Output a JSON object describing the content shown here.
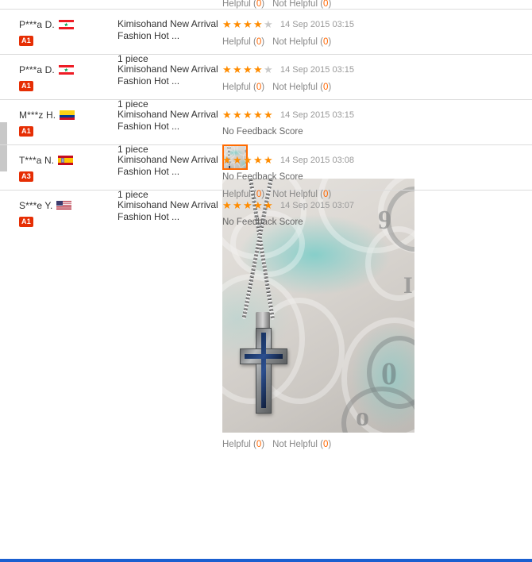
{
  "meta": {
    "accent_orange": "#ff6600",
    "star_on_color": "#ff8c00",
    "star_off_color": "#c9c9c9",
    "badge_color": "#e62e04",
    "divider_color": "#dcdcdc",
    "bottom_bar_color": "#1a5fd0"
  },
  "labels": {
    "helpful": "Helpful",
    "not_helpful": "Not Helpful",
    "no_feedback_score": "No Feedback Score",
    "open_paren": "(",
    "close_paren": ")"
  },
  "clipped_top_row": {
    "helpful_label": "Helpful",
    "helpful_count": "0",
    "not_helpful_label": "Not Helpful",
    "not_helpful_count": "0"
  },
  "reviews": [
    {
      "user": "P***a D.",
      "flag": "lebanon-flag",
      "badge": "A1",
      "product_title": "Kimisohand New Arrival Fashion Hot ...",
      "quantity": "1 piece",
      "rating": 4,
      "date": "14 Sep 2015 03:15",
      "feedback_score": "",
      "helpful_count": "0",
      "not_helpful_count": "0",
      "has_photo": false
    },
    {
      "user": "P***a D.",
      "flag": "lebanon-flag",
      "badge": "A1",
      "product_title": "Kimisohand New Arrival Fashion Hot ...",
      "quantity": "1 piece",
      "rating": 4,
      "date": "14 Sep 2015 03:15",
      "feedback_score": "",
      "helpful_count": "0",
      "not_helpful_count": "0",
      "has_photo": false
    },
    {
      "user": "M***z H.",
      "flag": "colombia-flag",
      "badge": "A1",
      "product_title": "Kimisohand New Arrival Fashion Hot ...",
      "quantity": "1 piece",
      "rating": 5,
      "date": "14 Sep 2015 03:15",
      "feedback_score": "No Feedback Score",
      "helpful_count": "0",
      "not_helpful_count": "0",
      "has_photo": true,
      "photo_alt": "cross-pendant-necklace-on-paisley-fabric"
    },
    {
      "user": "T***a N.",
      "flag": "spain-flag",
      "badge": "A3",
      "product_title": "Kimisohand New Arrival Fashion Hot ...",
      "quantity": "1 piece",
      "rating": 5,
      "date": "14 Sep 2015 03:08",
      "feedback_score": "No Feedback Score",
      "helpful_count": "0",
      "not_helpful_count": "0",
      "has_photo": false
    },
    {
      "user": "S***e Y.",
      "flag": "usa-flag",
      "badge": "A1",
      "product_title": "Kimisohand New Arrival Fashion Hot ...",
      "quantity": "",
      "rating": 5,
      "date": "14 Sep 2015 03:07",
      "feedback_score": "No Feedback Score",
      "helpful_count": "",
      "not_helpful_count": "",
      "has_photo": false
    }
  ]
}
